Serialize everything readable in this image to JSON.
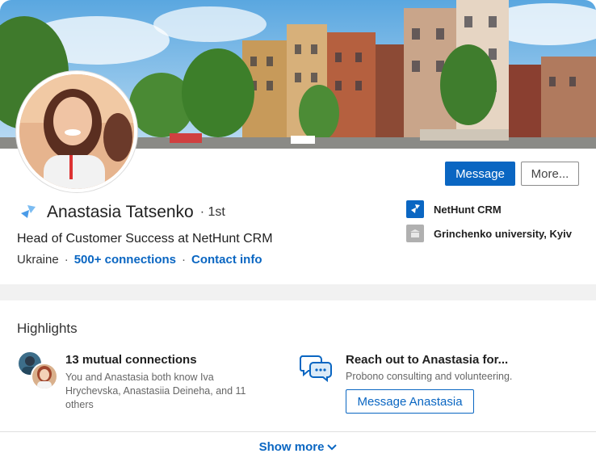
{
  "profile": {
    "name": "Anastasia Tatsenko",
    "degree": "· 1st",
    "headline": "Head of Customer Success at NetHunt CRM",
    "location": "Ukraine",
    "separator": "·",
    "connections": "500+ connections",
    "contact_info": "Contact info"
  },
  "actions": {
    "message_label": "Message",
    "more_label": "More..."
  },
  "organizations": [
    {
      "name": "NetHunt CRM",
      "icon": "nethunt-logo-icon",
      "color": "#0a66c2"
    },
    {
      "name": "Grinchenko university, Kyiv",
      "icon": "school-icon",
      "color": "#b0b0b0"
    }
  ],
  "highlights": {
    "title": "Highlights",
    "mutual": {
      "title": "13 mutual connections",
      "description": "You and Anastasia both know Iva Hrychevska, Anastasiia Deineha, and 11 others"
    },
    "reach": {
      "title": "Reach out to Anastasia for...",
      "description": "Probono consulting and volunteering.",
      "button_label": "Message Anastasia"
    },
    "show_more": "Show more"
  },
  "colors": {
    "accent": "#0a66c2",
    "band": "#f1f1f1"
  }
}
